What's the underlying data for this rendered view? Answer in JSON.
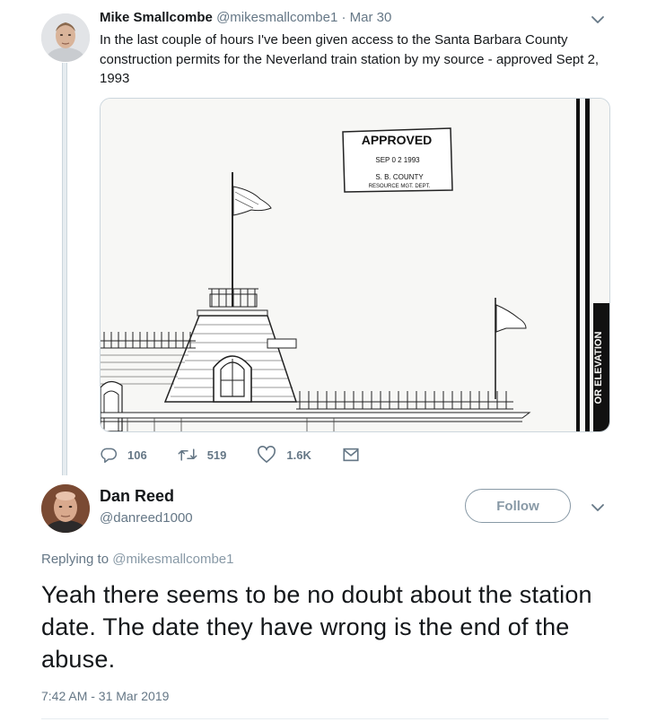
{
  "tweet1": {
    "author_name": "Mike Smallcombe",
    "author_handle": "@mikesmallcombe1",
    "separator": " · ",
    "date": "Mar 30",
    "text": "In the last couple of hours I've been given access to the Santa Barbara County construction permits for the Neverland train station by my source - approved Sept 2, 1993",
    "media": {
      "stamp_title": "APPROVED",
      "stamp_date": "SEP 0 2 1993",
      "stamp_line1": "S. B. COUNTY",
      "stamp_line2": "RESOURCE MGT. DEPT.",
      "side_label": "OR ELEVATION"
    },
    "actions": {
      "reply_icon": "reply-icon",
      "reply_count": "106",
      "retweet_icon": "retweet-icon",
      "retweet_count": "519",
      "like_icon": "heart-icon",
      "like_count": "1.6K",
      "dm_icon": "envelope-icon"
    }
  },
  "tweet2": {
    "author_name": "Dan Reed",
    "author_handle": "@danreed1000",
    "follow_label": "Follow",
    "replying_prefix": "Replying to ",
    "replying_to": "@mikesmallcombe1",
    "text": "Yeah there seems to be no doubt about the station date. The date they have wrong is the end of the abuse.",
    "timestamp": "7:42 AM - 31 Mar 2019"
  },
  "colors": {
    "text_primary": "#14171a",
    "text_secondary": "#657786",
    "border": "#ccd6dd",
    "follow_border": "#8899a6"
  }
}
